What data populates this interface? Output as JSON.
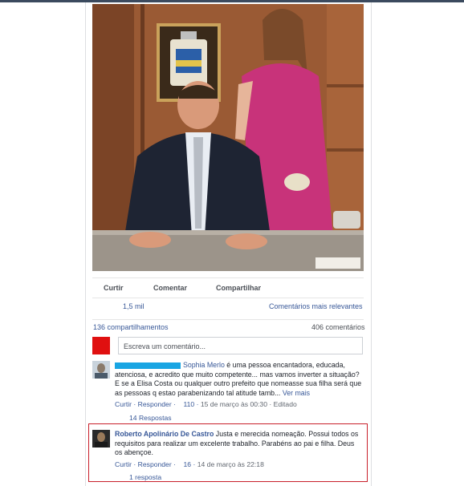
{
  "post": {
    "actions": {
      "like": "Curtir",
      "comment": "Comentar",
      "share": "Compartilhar"
    },
    "likes": "1,5 mil",
    "sort": "Comentários mais relevantes",
    "shares": "136 compartilhamentos",
    "comments_count": "406 comentários"
  },
  "composer": {
    "placeholder": "Escreva um comentário..."
  },
  "comments": [
    {
      "author": "Sophia Merlo",
      "text": "é uma pessoa encantadora, educada, atenciosa, e acredito que muito competente... mas vamos inverter a situação? E se a Elisa Costa ou qualquer outro prefeito que nomeasse sua filha será que as pessoas q estao parabenizando tal atitude tamb...",
      "see_more": "Ver mais",
      "like": "Curtir",
      "reply": "Responder",
      "reactions": "110",
      "time": "15 de março às 00:30 · Editado",
      "replies": "14 Respostas"
    },
    {
      "author": "Roberto Apolinário De Castro",
      "text": "Justa e merecida nomeação. Possui todos os requisitos para realizar um excelente trabalho. Parabéns ao pai e filha. Deus os abençoe.",
      "like": "Curtir",
      "reply": "Responder",
      "reactions": "16",
      "time": "14 de março às 22:18",
      "replies": "1 resposta"
    }
  ],
  "colors": {
    "link": "#385898",
    "highlight_border": "#c81f2a",
    "dress": "#c8337a",
    "wood": "#8a4e2c"
  }
}
